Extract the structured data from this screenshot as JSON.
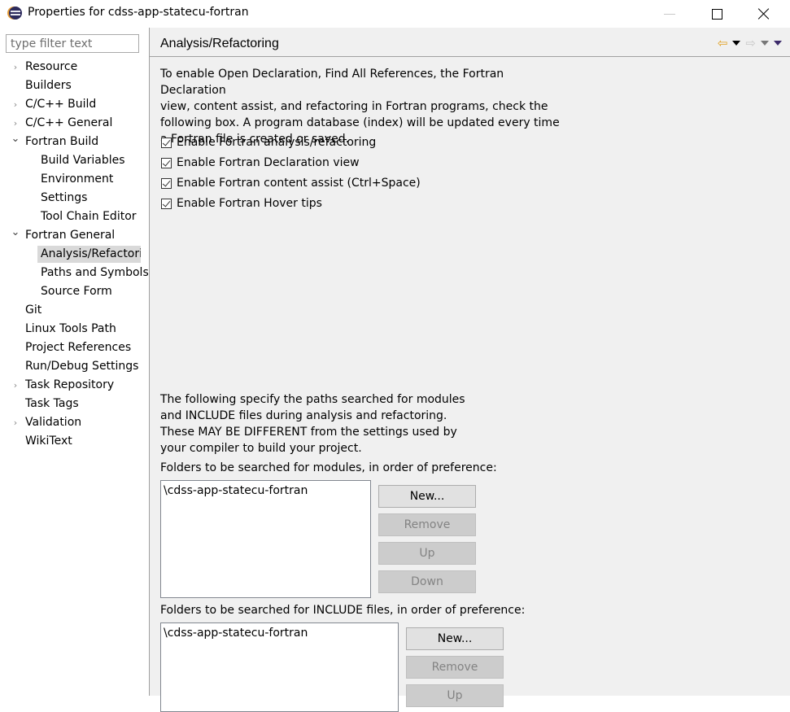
{
  "window": {
    "title": "Properties for cdss-app-statecu-fortran",
    "icon": "eclipse-icon",
    "controls": {
      "minimize": "minimize",
      "maximize": "maximize",
      "close": "close"
    }
  },
  "sidebar": {
    "filter_placeholder": "type filter text",
    "filter_value": "",
    "items": [
      {
        "label": "Resource",
        "level": 0,
        "expander": "collapsed"
      },
      {
        "label": "Builders",
        "level": 0,
        "expander": "none"
      },
      {
        "label": "C/C++ Build",
        "level": 0,
        "expander": "collapsed"
      },
      {
        "label": "C/C++ General",
        "level": 0,
        "expander": "collapsed"
      },
      {
        "label": "Fortran Build",
        "level": 0,
        "expander": "expanded"
      },
      {
        "label": "Build Variables",
        "level": 1,
        "expander": "none"
      },
      {
        "label": "Environment",
        "level": 1,
        "expander": "none"
      },
      {
        "label": "Settings",
        "level": 1,
        "expander": "none"
      },
      {
        "label": "Tool Chain Editor",
        "level": 1,
        "expander": "none"
      },
      {
        "label": "Fortran General",
        "level": 0,
        "expander": "expanded"
      },
      {
        "label": "Analysis/Refactoring",
        "level": 1,
        "expander": "none",
        "selected": true
      },
      {
        "label": "Paths and Symbols",
        "level": 1,
        "expander": "none"
      },
      {
        "label": "Source Form",
        "level": 1,
        "expander": "none"
      },
      {
        "label": "Git",
        "level": 0,
        "expander": "none"
      },
      {
        "label": "Linux Tools Path",
        "level": 0,
        "expander": "none"
      },
      {
        "label": "Project References",
        "level": 0,
        "expander": "none"
      },
      {
        "label": "Run/Debug Settings",
        "level": 0,
        "expander": "none"
      },
      {
        "label": "Task Repository",
        "level": 0,
        "expander": "collapsed"
      },
      {
        "label": "Task Tags",
        "level": 0,
        "expander": "none"
      },
      {
        "label": "Validation",
        "level": 0,
        "expander": "collapsed"
      },
      {
        "label": "WikiText",
        "level": 0,
        "expander": "none"
      }
    ]
  },
  "main": {
    "title": "Analysis/Refactoring",
    "nav": {
      "back": "back-arrow",
      "forward": "forward-arrow",
      "menu": "view-menu"
    },
    "intro": "To enable Open Declaration, Find All References, the Fortran Declaration\nview, content assist, and refactoring in Fortran programs, check the\nfollowing box.  A program database (index) will be updated every time\na Fortran file is created or saved.",
    "checkboxes": [
      {
        "label": "Enable Fortran analysis/refactoring",
        "checked": true
      },
      {
        "label": "Enable Fortran Declaration view",
        "checked": true
      },
      {
        "label": "Enable Fortran content assist (Ctrl+Space)",
        "checked": true
      },
      {
        "label": "Enable Fortran Hover tips",
        "checked": true
      }
    ],
    "paths_note": "The following specify the paths searched for modules\nand INCLUDE files during analysis and refactoring.\nThese MAY BE DIFFERENT from the settings used by\nyour compiler to build your project.",
    "modules": {
      "label": "Folders to be searched for modules, in order of preference:",
      "items": [
        "\\cdss-app-statecu-fortran"
      ],
      "buttons": {
        "new": "New...",
        "remove": "Remove",
        "up": "Up",
        "down": "Down"
      }
    },
    "includes": {
      "label": "Folders to be searched for INCLUDE files, in order of preference:",
      "items": [
        "\\cdss-app-statecu-fortran"
      ],
      "buttons": {
        "new": "New...",
        "remove": "Remove",
        "up": "Up"
      }
    }
  },
  "colors": {
    "selection": "#d9d9d9",
    "panel_bg": "#f0f0f0",
    "back_arrow": "#e0a020"
  }
}
